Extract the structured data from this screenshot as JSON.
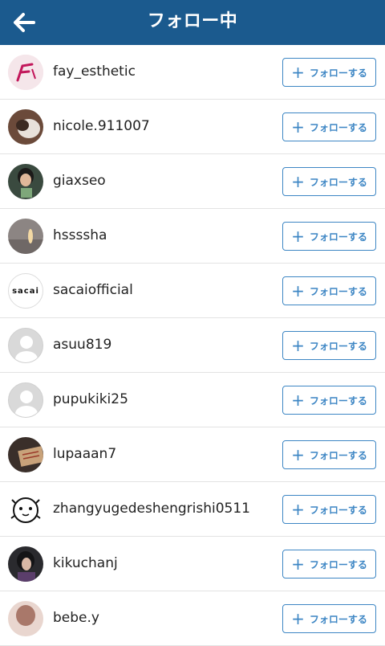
{
  "header": {
    "title": "フォロー中",
    "back_icon": "arrow-left-icon",
    "background_color": "#1b5a8e"
  },
  "follow_button_label": "フォローする",
  "accent_color": "#3d86c4",
  "users": [
    {
      "username": "fay_esthetic",
      "avatar": "photo"
    },
    {
      "username": "nicole.911007",
      "avatar": "photo"
    },
    {
      "username": "giaxseo",
      "avatar": "photo"
    },
    {
      "username": "hssssha",
      "avatar": "photo"
    },
    {
      "username": "sacaiofficial",
      "avatar": "logo",
      "avatar_text": "sacai"
    },
    {
      "username": "asuu819",
      "avatar": "default"
    },
    {
      "username": "pupukiki25",
      "avatar": "default"
    },
    {
      "username": "lupaaan7",
      "avatar": "photo"
    },
    {
      "username": "zhangyugedeshengrishi0511",
      "avatar": "illustration"
    },
    {
      "username": "kikuchanj",
      "avatar": "photo"
    },
    {
      "username": "bebe.y",
      "avatar": "photo"
    }
  ]
}
